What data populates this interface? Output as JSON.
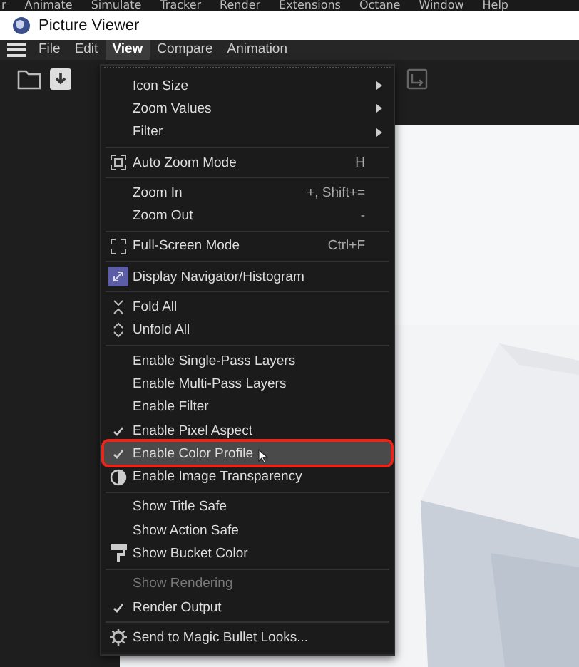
{
  "app_menu": [
    "r",
    "Animate",
    "Simulate",
    "Tracker",
    "Render",
    "Extensions",
    "Octane",
    "Window",
    "Help"
  ],
  "window": {
    "title": "Picture Viewer"
  },
  "menubar": [
    {
      "label": "File",
      "selected": false
    },
    {
      "label": "Edit",
      "selected": false
    },
    {
      "label": "View",
      "selected": true
    },
    {
      "label": "Compare",
      "selected": false
    },
    {
      "label": "Animation",
      "selected": false
    }
  ],
  "view_menu": {
    "sections": [
      [
        {
          "label": "Icon Size",
          "kind": "submenu",
          "checked": false,
          "disabled": false,
          "selected": false,
          "outlined": false
        },
        {
          "label": "Zoom Values",
          "kind": "submenu",
          "checked": false,
          "disabled": false,
          "selected": false,
          "outlined": false
        },
        {
          "label": "Filter",
          "kind": "submenu",
          "checked": false,
          "disabled": false,
          "selected": false,
          "outlined": false
        }
      ],
      [
        {
          "label": "Auto Zoom Mode",
          "kind": "icon",
          "shortcut": "H",
          "checked": false,
          "disabled": false,
          "selected": false,
          "outlined": false
        }
      ],
      [
        {
          "label": "Zoom In",
          "kind": "plain",
          "shortcut": "+, Shift+=",
          "checked": false,
          "disabled": false,
          "selected": false,
          "outlined": false
        },
        {
          "label": "Zoom Out",
          "kind": "plain",
          "shortcut": "-",
          "checked": false,
          "disabled": false,
          "selected": false,
          "outlined": false
        }
      ],
      [
        {
          "label": "Full-Screen Mode",
          "kind": "icon",
          "shortcut": "Ctrl+F",
          "checked": false,
          "disabled": false,
          "selected": false,
          "outlined": false
        }
      ],
      [
        {
          "label": "Display Navigator/Histogram",
          "kind": "icon",
          "checked": false,
          "disabled": false,
          "selected": false,
          "outlined": false
        }
      ],
      [
        {
          "label": "Fold All",
          "kind": "icon",
          "checked": false,
          "disabled": false,
          "selected": false,
          "outlined": false
        },
        {
          "label": "Unfold All",
          "kind": "icon",
          "checked": false,
          "disabled": false,
          "selected": false,
          "outlined": false
        }
      ],
      [
        {
          "label": "Enable Single-Pass Layers",
          "kind": "plain",
          "checked": false,
          "disabled": false,
          "selected": false,
          "outlined": false
        },
        {
          "label": "Enable Multi-Pass Layers",
          "kind": "plain",
          "checked": false,
          "disabled": false,
          "selected": false,
          "outlined": false
        },
        {
          "label": "Enable Filter",
          "kind": "plain",
          "checked": false,
          "disabled": false,
          "selected": false,
          "outlined": false
        },
        {
          "label": "Enable Pixel Aspect",
          "kind": "plain",
          "checked": true,
          "disabled": false,
          "selected": false,
          "outlined": false
        },
        {
          "label": "Enable Color Profile",
          "kind": "plain",
          "checked": true,
          "disabled": false,
          "selected": true,
          "outlined": true
        },
        {
          "label": "Enable Image Transparency",
          "kind": "icon",
          "checked": false,
          "disabled": false,
          "selected": false,
          "outlined": false
        }
      ],
      [
        {
          "label": "Show Title Safe",
          "kind": "plain",
          "checked": false,
          "disabled": false,
          "selected": false,
          "outlined": false
        },
        {
          "label": "Show Action Safe",
          "kind": "plain",
          "checked": false,
          "disabled": false,
          "selected": false,
          "outlined": false
        },
        {
          "label": "Show Bucket Color",
          "kind": "icon",
          "checked": false,
          "disabled": false,
          "selected": false,
          "outlined": false
        }
      ],
      [
        {
          "label": "Show Rendering",
          "kind": "plain",
          "checked": false,
          "disabled": true,
          "selected": false,
          "outlined": false
        },
        {
          "label": "Render Output",
          "kind": "plain",
          "checked": true,
          "disabled": false,
          "selected": false,
          "outlined": false
        }
      ],
      [
        {
          "label": "Send to Magic Bullet Looks...",
          "kind": "icon",
          "checked": false,
          "disabled": false,
          "selected": false,
          "outlined": false
        }
      ]
    ]
  }
}
